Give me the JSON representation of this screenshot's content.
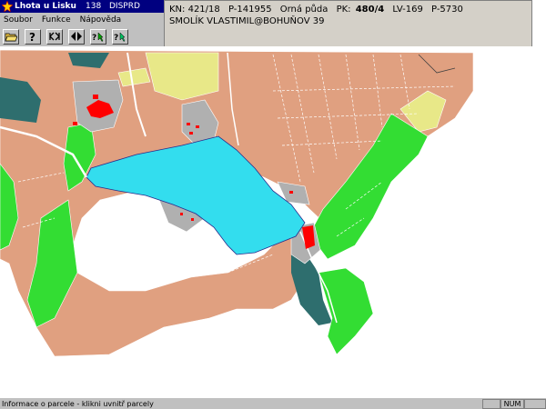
{
  "titlebar": {
    "title": "Lhota u Lisku",
    "number": "138",
    "app": "DISPRD"
  },
  "menu": {
    "items": [
      "Soubor",
      "Funkce",
      "Nápověda"
    ]
  },
  "toolbar": {
    "buttons": [
      "open-folder-icon",
      "help-icon",
      "zoom-extent-icon",
      "zoom-in-out-icon",
      "identify-icon",
      "select-icon"
    ]
  },
  "info": {
    "kn": "KN: 421/18",
    "p": "P-141955",
    "use": "Orná půda",
    "pk_label": "PK:",
    "pk_value": "480/4",
    "lv": "LV-169",
    "p2": "P-5730",
    "owner": "SMOLÍK VLASTIMIL@BOHUŇOV 39"
  },
  "colors": {
    "arable": "#e0a080",
    "meadow": "#33dd33",
    "forest": "#2e6e6e",
    "water": "#33ddee",
    "built": "#b0b0b0",
    "building": "#ff0000",
    "garden": "#e8e888"
  },
  "status": {
    "text": "Informace o parcele - klikni uvnitř parcely",
    "indicator": "NUM"
  }
}
